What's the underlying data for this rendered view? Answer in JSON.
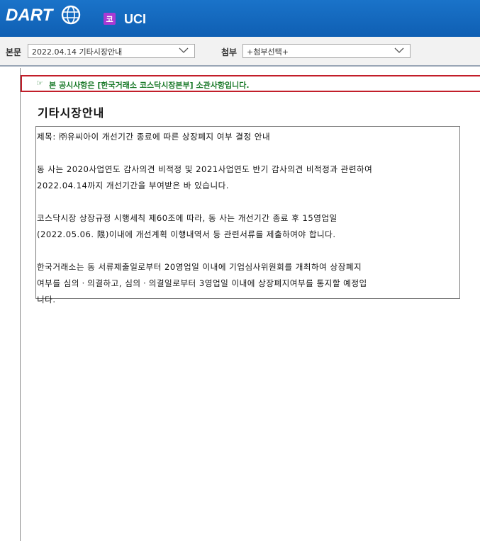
{
  "header": {
    "logo_text": "DART",
    "market_badge": "코",
    "company_name": "UCI"
  },
  "toolbar": {
    "body_label": "본문",
    "body_select_value": "2022.04.14  기타시장안내",
    "attach_label": "첨부",
    "attach_select_value": "+첨부선택+"
  },
  "notice": {
    "text": "본 공시사항은 [한국거래소 코스닥시장본부] 소관사항입니다."
  },
  "document": {
    "title": "기타시장안내",
    "lines": {
      "subject": "제목: ㈜유씨아이 개선기간 종료에 따른 상장폐지 여부 결정 안내",
      "p1_l1": "동 사는 2020사업연도 감사의견 비적정 및 2021사업연도 반기 감사의견 비적정과 관련하여",
      "p1_l2": "2022.04.14까지 개선기간을 부여받은 바 있습니다.",
      "p2_l1": "코스닥시장 상장규정 시행세칙 제60조에 따라, 동 사는 개선기간 종료 후 15영업일",
      "p2_l2": "(2022.05.06. 限)이내에 개선계획 이행내역서 등 관련서류를 제출하여야 합니다.",
      "p3_l1": "한국거래소는 동 서류제출일로부터 20영업일 이내에 기업심사위원회를 개최하여 상장폐지",
      "p3_l2": "여부를 심의ㆍ의결하고, 심의ㆍ의결일로부터 3영업일 이내에 상장폐지여부를 통지할 예정입",
      "p3_l3": "니다."
    }
  },
  "colors": {
    "header_blue": "#1467c1",
    "badge_purple": "#a93ad3",
    "notice_border": "#c21e2a",
    "notice_text": "#1b7a2a"
  },
  "icons": {
    "logo_globe": "globe-icon",
    "dropdown": "chevron-down-icon",
    "notice_pointer": "hand-pointer-icon"
  }
}
